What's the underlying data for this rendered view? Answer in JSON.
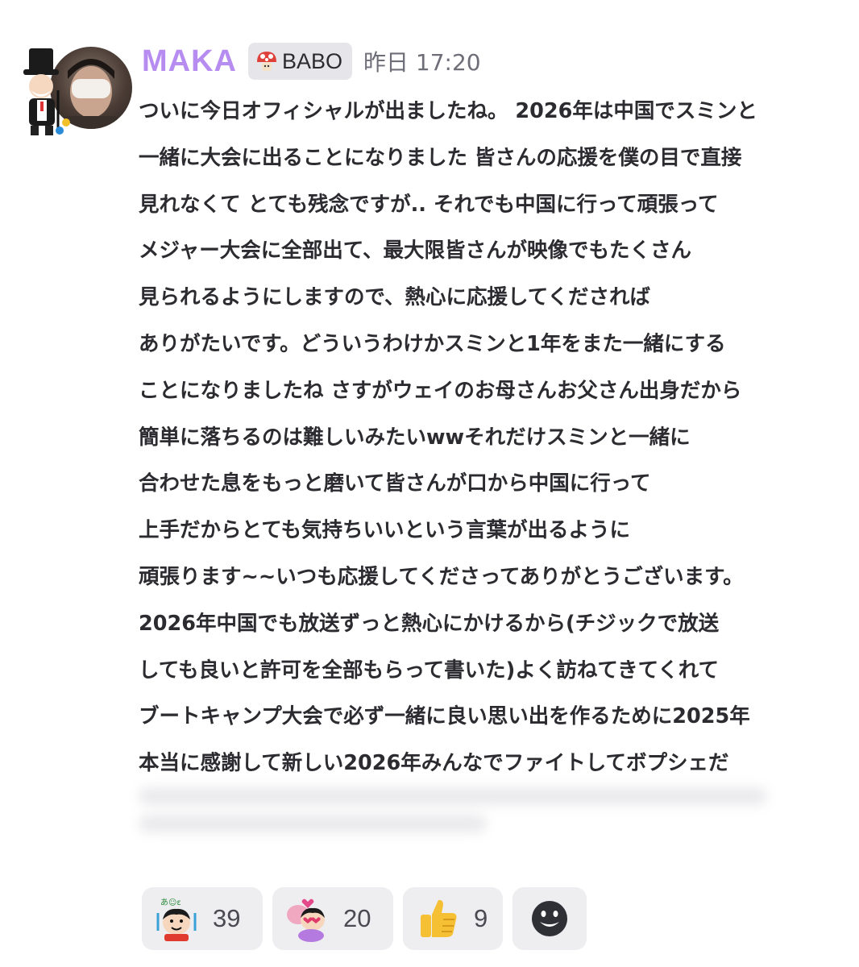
{
  "header": {
    "username": "MAKA",
    "role_badge": "BABO",
    "timestamp": "昨日 17:20"
  },
  "message_lines": [
    "ついに今日オフィシャルが出ましたね。 2026年は中国でスミンと",
    "一緒に大会に出ることになりました 皆さんの応援を僕の目で直接",
    "見れなくて とても残念ですが.. それでも中国に行って頑張って",
    "メジャー大会に全部出て、最大限皆さんが映像でもたくさん",
    "見られるようにしますので、熱心に応援してくだされば",
    "ありがたいです。どういうわけかスミンと1年をまた一緒にする",
    "ことになりましたね さすがウェイのお母さんお父さん出身だから",
    "簡単に落ちるのは難しいみたいwwそれだけスミンと一緒に",
    "合わせた息をもっと磨いて皆さんが口から中国に行って",
    "上手だからとても気持ちいいという言葉が出るように",
    "頑張ります~~いつも応援してくださってありがとうございます。",
    "2026年中国でも放送ずっと熱心にかけるから(チジックで放送",
    "しても良いと許可を全部もらって書いた)よく訪ねてきてくれて",
    "ブートキャンプ大会で必ず一緒に良い思い出を作るために2025年",
    "本当に感謝して新しい2026年みんなでファイトしてボプシェだ"
  ],
  "reactions": [
    {
      "icon": "shinchan-cheer-sticker",
      "count": "39"
    },
    {
      "icon": "shinchan-heart-sticker",
      "count": "20"
    },
    {
      "icon": "thumbs-up-icon",
      "count": "9"
    }
  ],
  "add_reaction_icon": "smiley-add-icon",
  "colors": {
    "username": "#b78cf0",
    "badge_bg": "#e6e6ea",
    "reaction_bg": "#eeeef1",
    "text": "#2b2b30"
  }
}
